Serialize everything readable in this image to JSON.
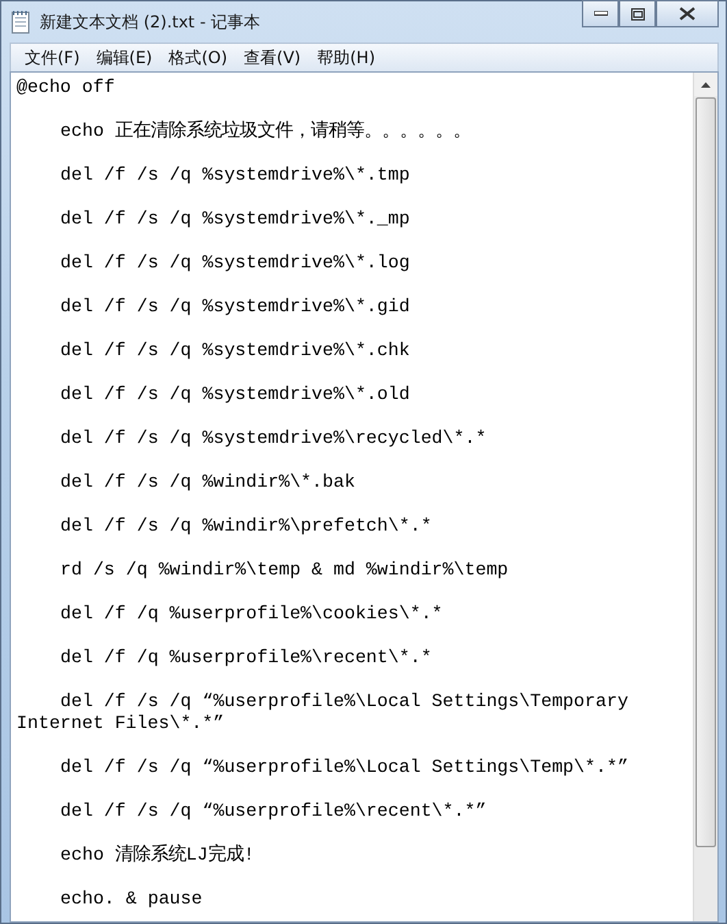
{
  "window": {
    "title": "新建文本文档 (2).txt - 记事本"
  },
  "menu": [
    "文件(F)",
    "编辑(E)",
    "格式(O)",
    "查看(V)",
    "帮助(H)"
  ],
  "lines": [
    {
      "text": "@echo off",
      "indented": false
    },
    {
      "text": "echo 正在清除系统垃圾文件，请稍等。。。。。。",
      "indented": true
    },
    {
      "text": "del /f /s /q %systemdrive%\\*.tmp",
      "indented": true
    },
    {
      "text": "del /f /s /q %systemdrive%\\*._mp",
      "indented": true
    },
    {
      "text": "del /f /s /q %systemdrive%\\*.log",
      "indented": true
    },
    {
      "text": "del /f /s /q %systemdrive%\\*.gid",
      "indented": true
    },
    {
      "text": "del /f /s /q %systemdrive%\\*.chk",
      "indented": true
    },
    {
      "text": "del /f /s /q %systemdrive%\\*.old",
      "indented": true
    },
    {
      "text": "del /f /s /q %systemdrive%\\recycled\\*.*",
      "indented": true
    },
    {
      "text": "del /f /s /q %windir%\\*.bak",
      "indented": true
    },
    {
      "text": "del /f /s /q %windir%\\prefetch\\*.*",
      "indented": true
    },
    {
      "text": "rd /s /q %windir%\\temp & md %windir%\\temp",
      "indented": true
    },
    {
      "text": "del /f /q %userprofile%\\cookies\\*.*",
      "indented": true
    },
    {
      "text": "del /f /q %userprofile%\\recent\\*.*",
      "indented": true
    },
    {
      "text": "del /f /s /q “%userprofile%\\Local Settings\\Temporary Internet Files\\*.*”",
      "indented": true
    },
    {
      "text": "del /f /s /q “%userprofile%\\Local Settings\\Temp\\*.*”",
      "indented": true
    },
    {
      "text": "del /f /s /q “%userprofile%\\recent\\*.*”",
      "indented": true
    },
    {
      "text": "echo 清除系统LJ完成!",
      "indented": true
    },
    {
      "text": "echo. & pause",
      "indented": true
    }
  ]
}
